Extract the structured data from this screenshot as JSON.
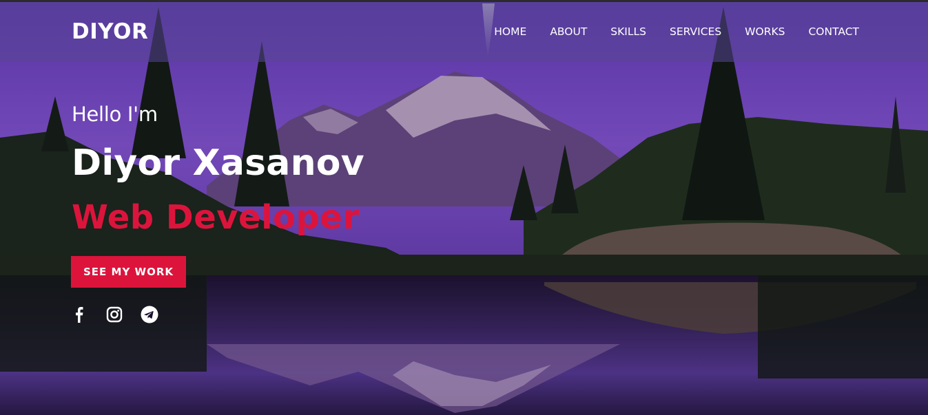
{
  "brand": {
    "logo": "DIYOR"
  },
  "nav": {
    "items": [
      {
        "label": "HOME"
      },
      {
        "label": "ABOUT"
      },
      {
        "label": "SKILLS"
      },
      {
        "label": "SERVICES"
      },
      {
        "label": "WORKS"
      },
      {
        "label": "CONTACT"
      }
    ]
  },
  "hero": {
    "greeting": "Hello I'm",
    "name": "Diyor Xasanov",
    "role": "Web Developer",
    "cta_label": "SEE MY WORK"
  },
  "socials": [
    {
      "icon": "facebook-icon"
    },
    {
      "icon": "instagram-icon"
    },
    {
      "icon": "telegram-icon"
    }
  ],
  "colors": {
    "accent": "#dc143c",
    "text": "#ffffff",
    "sky": "#7b4bd0",
    "navbar": "#5a4696"
  }
}
